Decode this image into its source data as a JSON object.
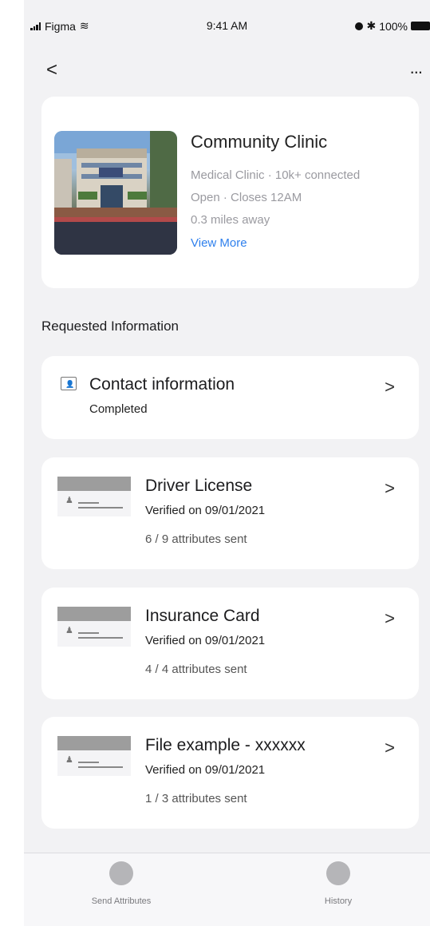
{
  "status_bar": {
    "carrier": "Figma",
    "time": "9:41 AM",
    "battery": "100%"
  },
  "nav": {
    "back": "<",
    "more": "..."
  },
  "clinic": {
    "name": "Community Clinic",
    "type_line": "Medical Clinic · 10k+ connected",
    "hours_line": "Open · Closes 12AM",
    "distance_line": "0.3 miles away",
    "link": "View More"
  },
  "section_title": "Requested Information",
  "contact": {
    "title": "Contact information",
    "status": "Completed"
  },
  "documents": [
    {
      "title": "Driver License",
      "verified": "Verified on 09/01/2021",
      "count": "6 / 9 attributes sent"
    },
    {
      "title": "Insurance Card",
      "verified": "Verified on 09/01/2021",
      "count": "4 / 4 attributes sent"
    },
    {
      "title": "File example - xxxxxx",
      "verified": "Verified on 09/01/2021",
      "count": "1 / 3 attributes sent"
    }
  ],
  "chevron": ">",
  "tabbar": {
    "send": "Send Attributes",
    "history": "History"
  }
}
